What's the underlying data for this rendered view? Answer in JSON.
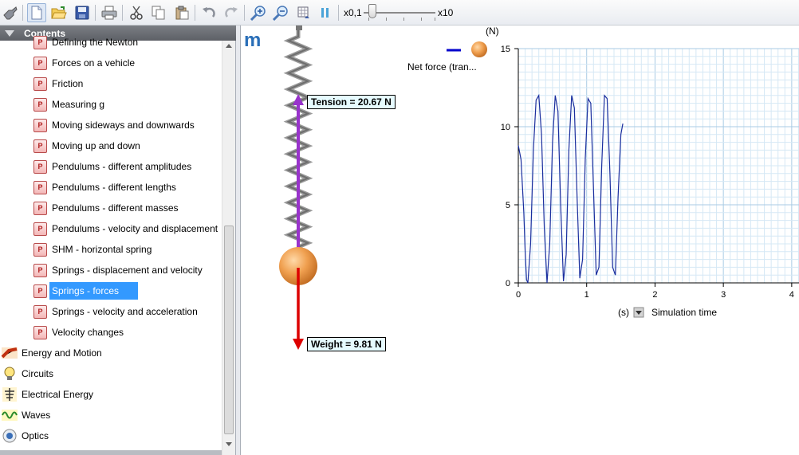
{
  "toolbar": {
    "speed_min_label": "x0,1",
    "speed_max_label": "x10",
    "icons": [
      "tools-icon",
      "new-document-icon",
      "open-folder-icon",
      "save-icon",
      "print-icon",
      "cut-icon",
      "copy-icon",
      "paste-icon",
      "undo-icon",
      "redo-icon",
      "zoom-in-icon",
      "zoom-out-icon",
      "grid-icon",
      "pause-icon"
    ]
  },
  "contents": {
    "title": "Contents",
    "lessons": [
      {
        "label": "Defining the Newton"
      },
      {
        "label": "Forces on a vehicle"
      },
      {
        "label": "Friction"
      },
      {
        "label": "Measuring g"
      },
      {
        "label": "Moving sideways and downwards"
      },
      {
        "label": "Moving up and down"
      },
      {
        "label": "Pendulums - different amplitudes"
      },
      {
        "label": "Pendulums - different lengths"
      },
      {
        "label": "Pendulums - different masses"
      },
      {
        "label": "Pendulums - velocity and displacement"
      },
      {
        "label": "SHM - horizontal spring"
      },
      {
        "label": "Springs - displacement and velocity"
      },
      {
        "label": "Springs - forces",
        "selected": true
      },
      {
        "label": "Springs - velocity and acceleration"
      },
      {
        "label": "Velocity changes"
      }
    ],
    "categories": [
      {
        "label": "Energy and Motion",
        "icon": "energy-motion-icon"
      },
      {
        "label": "Circuits",
        "icon": "circuits-icon"
      },
      {
        "label": "Electrical Energy",
        "icon": "electrical-energy-icon"
      },
      {
        "label": "Waves",
        "icon": "waves-icon"
      },
      {
        "label": "Optics",
        "icon": "optics-icon"
      }
    ],
    "lesson_icon_letter": "P"
  },
  "simulation": {
    "logo": "m",
    "tension_label": "Tension = 20.67 N",
    "weight_label": "Weight = 9.81 N",
    "legend_label": "Net force (tran...",
    "y_unit": "(N)",
    "x_unit": "(s)",
    "x_title": "Simulation time",
    "colors": {
      "tension": "#9933cc",
      "weight": "#dd0000",
      "trace": "#1a2e9e",
      "mass": "#f0a050"
    }
  },
  "chart_data": {
    "type": "line",
    "title": "",
    "xlabel": "Simulation time",
    "ylabel": "",
    "xlim": [
      0,
      4.2
    ],
    "ylim": [
      0,
      15
    ],
    "xticks": [
      0,
      1,
      2,
      3,
      4
    ],
    "yticks": [
      0,
      5,
      10,
      15
    ],
    "grid": true,
    "series": [
      {
        "name": "Net force (tran...",
        "x": [
          0.0,
          0.04,
          0.08,
          0.1,
          0.12,
          0.14,
          0.18,
          0.22,
          0.26,
          0.3,
          0.34,
          0.38,
          0.42,
          0.46,
          0.5,
          0.54,
          0.58,
          0.62,
          0.66,
          0.7,
          0.74,
          0.78,
          0.82,
          0.86,
          0.9,
          0.94,
          0.98,
          1.02,
          1.06,
          1.1,
          1.14,
          1.18,
          1.22,
          1.26,
          1.3,
          1.34,
          1.38,
          1.42,
          1.46,
          1.5,
          1.53
        ],
        "y": [
          8.8,
          7.9,
          4.5,
          2.0,
          0.2,
          0.0,
          2.5,
          8.5,
          11.7,
          12.0,
          9.5,
          3.5,
          0.0,
          2.5,
          9.0,
          12.0,
          11.0,
          5.0,
          0.1,
          1.8,
          8.5,
          12.0,
          11.2,
          5.5,
          0.3,
          1.5,
          8.0,
          11.8,
          11.5,
          6.0,
          0.5,
          1.0,
          7.5,
          12.0,
          11.8,
          7.0,
          1.0,
          0.5,
          5.5,
          9.5,
          10.2
        ]
      }
    ]
  }
}
